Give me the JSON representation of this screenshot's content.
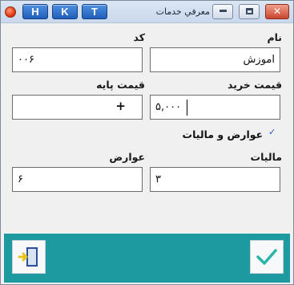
{
  "titlebar": {
    "title": "معرفي خدمات",
    "hotkeys": [
      "H",
      "K",
      "T"
    ],
    "close_glyph": "✕"
  },
  "form": {
    "name_label": "نام",
    "name_value": "آموزش",
    "code_label": "کد",
    "code_value": "۰۰۶",
    "purchase_price_label": "قيمت خريد",
    "purchase_price_value": "۵,۰۰۰",
    "base_price_label": "قيمت پايه",
    "base_price_value": "+",
    "duties_tax_checkbox_label": "عوارض و ماليات",
    "duties_tax_checked": true,
    "tax_label": "ماليات",
    "tax_value": "۳",
    "duties_label": "عوارض",
    "duties_value": "۶"
  },
  "colors": {
    "footer": "#1c9aa0",
    "confirm_check": "#2bb5a8",
    "exit_arrow": "#e8c417"
  }
}
